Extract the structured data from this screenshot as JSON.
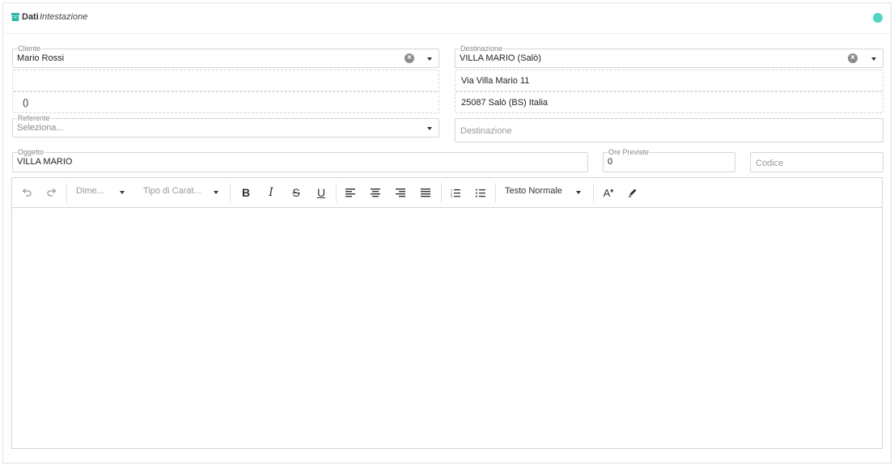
{
  "header": {
    "title": "Dati",
    "subtitle": "Intestazione",
    "icon": "archive-icon",
    "status_color": "#4fd6c3"
  },
  "form": {
    "cliente": {
      "label": "Cliente",
      "value": "Mario Rossi"
    },
    "cliente_extra1": "",
    "cliente_extra2": "()",
    "destinazione_select": {
      "label": "Destinazione",
      "value": "VILLA MARIO  (Salò)"
    },
    "dest_address1": "Via Villa Mario 11",
    "dest_address2": "25087 Salò (BS) Italia",
    "referente": {
      "label": "Referente",
      "placeholder": "Seleziona..."
    },
    "destinazione_input": {
      "placeholder": "Destinazione"
    },
    "oggetto": {
      "label": "Oggetto",
      "value": "VILLA MARIO"
    },
    "ore_previste": {
      "label": "Ore Previste",
      "value": "0"
    },
    "codice": {
      "placeholder": "Codice"
    }
  },
  "toolbar": {
    "size_label": "Dime...",
    "font_label": "Tipo di Carat...",
    "bold": "B",
    "italic": "I",
    "strike": "S",
    "underline": "U",
    "style_label": "Testo Normale",
    "text_color": "A"
  }
}
